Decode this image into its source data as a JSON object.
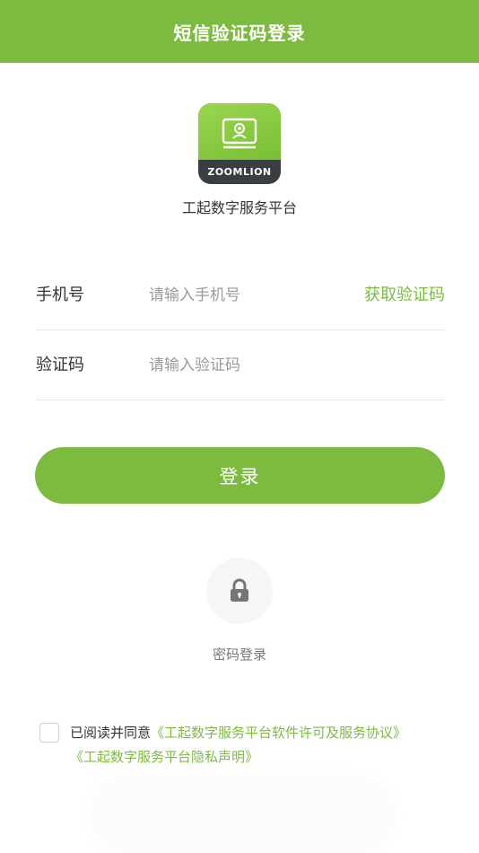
{
  "header": {
    "title": "短信验证码登录"
  },
  "logo": {
    "brand_text": "ZOOMLION"
  },
  "app": {
    "name": "工起数字服务平台"
  },
  "form": {
    "phone": {
      "label": "手机号",
      "placeholder": "请输入手机号",
      "value": ""
    },
    "get_code_label": "获取验证码",
    "code": {
      "label": "验证码",
      "placeholder": "请输入验证码",
      "value": ""
    }
  },
  "login_button": {
    "label": "登录"
  },
  "password_login": {
    "label": "密码登录",
    "icon": "lock-icon"
  },
  "agreement": {
    "prefix": "已阅读并同意",
    "terms_link": "《工起数字服务平台软件许可及服务协议》",
    "privacy_link": "《工起数字服务平台隐私声明》",
    "checked": false
  },
  "colors": {
    "accent": "#7cbb3f",
    "logo_bottom": "#3a3d41"
  }
}
